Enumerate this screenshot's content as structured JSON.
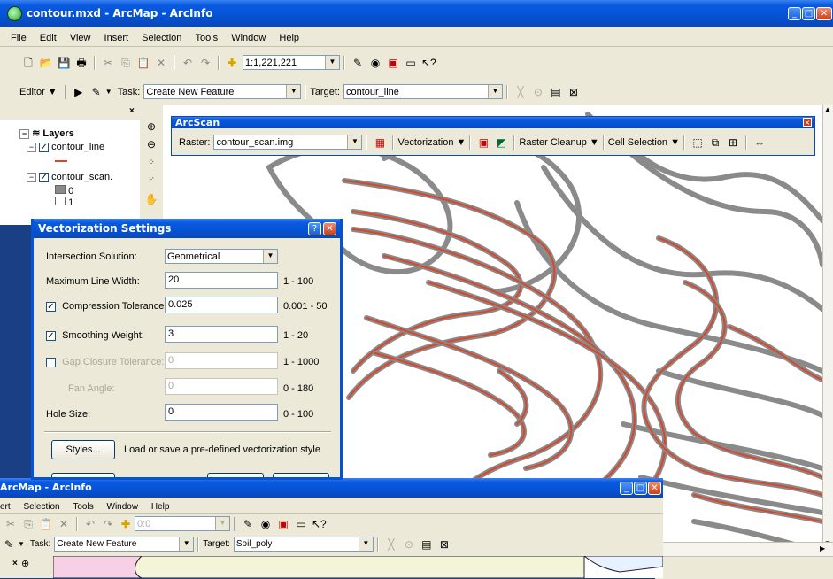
{
  "main_window": {
    "title": "contour.mxd - ArcMap - ArcInfo",
    "menus": [
      "File",
      "Edit",
      "View",
      "Insert",
      "Selection",
      "Tools",
      "Window",
      "Help"
    ],
    "scale": "1:1,221,221",
    "editor_label": "Editor",
    "task_label": "Task:",
    "task_value": "Create New Feature",
    "target_label": "Target:",
    "target_value": "contour_line"
  },
  "toc": {
    "root": "Layers",
    "layers": [
      {
        "name": "contour_line",
        "checked": true
      },
      {
        "name": "contour_scan.",
        "checked": true
      }
    ],
    "legend_items": [
      "0",
      "1"
    ]
  },
  "arcscan": {
    "title": "ArcScan",
    "raster_label": "Raster:",
    "raster_value": "contour_scan.img",
    "vectorization": "Vectorization",
    "raster_cleanup": "Raster Cleanup",
    "cell_selection": "Cell Selection"
  },
  "vector_settings": {
    "title": "Vectorization Settings",
    "intersection_label": "Intersection Solution:",
    "intersection_value": "Geometrical",
    "max_width_label": "Maximum Line Width:",
    "max_width_value": "20",
    "max_width_range": "1 - 100",
    "compression_label": "Compression Tolerance:",
    "compression_value": "0.025",
    "compression_range": "0.001 - 50",
    "smoothing_label": "Smoothing Weight:",
    "smoothing_value": "3",
    "smoothing_range": "1 - 20",
    "gap_label": "Gap Closure Tolerance:",
    "gap_value": "0",
    "gap_range": "1 - 1000",
    "fan_label": "Fan Angle:",
    "fan_value": "0",
    "fan_range": "0 - 180",
    "hole_label": "Hole Size:",
    "hole_value": "0",
    "hole_range": "0 - 100",
    "styles_button": "Styles...",
    "styles_desc": "Load or save a pre-defined vectorization style"
  },
  "second_window": {
    "title": "ArcMap - ArcInfo",
    "menus": [
      "ert",
      "Selection",
      "Tools",
      "Window",
      "Help"
    ],
    "scale": "0:0",
    "task_label": "Task:",
    "task_value": "Create New Feature",
    "target_label": "Target:",
    "target_value": "Soil_poly"
  },
  "colors": {
    "xp_blue": "#0553d5",
    "contour_gray": "#8a8a8a",
    "contour_red": "#d9472b",
    "dialog_bg": "#ece9d8"
  }
}
